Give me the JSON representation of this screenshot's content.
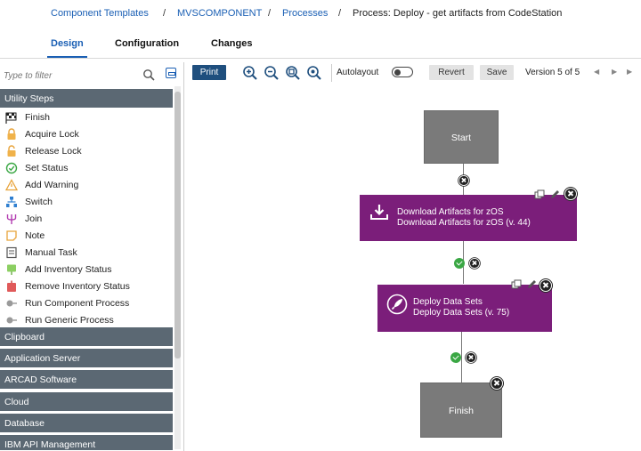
{
  "breadcrumb": {
    "items": [
      "Component Templates",
      "MVSCOMPONENT",
      "Processes"
    ],
    "separator": "/",
    "current": "Process: Deploy - get artifacts from CodeStation"
  },
  "tabs": [
    {
      "label": "Design",
      "active": true
    },
    {
      "label": "Configuration",
      "active": false
    },
    {
      "label": "Changes",
      "active": false
    }
  ],
  "palette": {
    "filter_placeholder": "Type to filter",
    "utility_header": "Utility Steps",
    "steps": [
      {
        "label": "Finish",
        "icon": "flag-icon"
      },
      {
        "label": "Acquire Lock",
        "icon": "lock-icon"
      },
      {
        "label": "Release Lock",
        "icon": "unlock-icon"
      },
      {
        "label": "Set Status",
        "icon": "status-check-icon"
      },
      {
        "label": "Add Warning",
        "icon": "warning-icon"
      },
      {
        "label": "Switch",
        "icon": "switch-icon"
      },
      {
        "label": "Join",
        "icon": "join-icon"
      },
      {
        "label": "Note",
        "icon": "note-icon"
      },
      {
        "label": "Manual Task",
        "icon": "manual-task-icon"
      },
      {
        "label": "Add Inventory Status",
        "icon": "add-inventory-icon"
      },
      {
        "label": "Remove Inventory Status",
        "icon": "remove-inventory-icon"
      },
      {
        "label": "Run Component Process",
        "icon": "run-process-icon"
      },
      {
        "label": "Run Generic Process",
        "icon": "run-process-icon"
      }
    ],
    "categories": [
      "Clipboard",
      "Application Server",
      "ARCAD Software",
      "Cloud",
      "Database",
      "IBM API Management"
    ]
  },
  "toolbar": {
    "print_label": "Print",
    "zoom_icons": [
      "zoom-in-icon",
      "zoom-out-icon",
      "zoom-fit-icon",
      "zoom-reset-icon"
    ],
    "autolayout_label": "Autolayout",
    "autolayout_on": false,
    "revert_label": "Revert",
    "save_label": "Save",
    "version_label": "Version 5 of 5"
  },
  "process": {
    "start_label": "Start",
    "finish_label": "Finish",
    "steps": [
      {
        "line1": "Download Artifacts for zOS",
        "line2": "Download Artifacts for zOS (v. 44)",
        "icon": "download-icon"
      },
      {
        "line1": "Deploy Data Sets",
        "line2": "Deploy Data Sets (v. 75)",
        "icon": "rocket-icon"
      }
    ]
  },
  "colors": {
    "link": "#1a5fb4",
    "section_header": "#5b6873",
    "step_node": "#7b1e7a",
    "terminal_node": "#7a7a7a",
    "print_button": "#1f4f7e",
    "success": "#3aa744"
  }
}
